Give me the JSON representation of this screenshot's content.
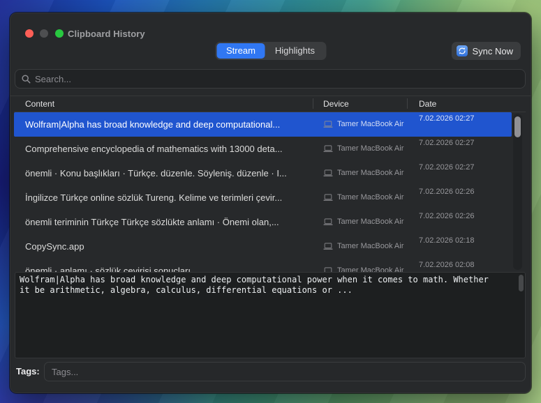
{
  "window": {
    "title": "Clipboard History"
  },
  "traffic_lights": {
    "close_color": "#fe5f57",
    "minimize_color": "#4e4f51",
    "zoom_color": "#28c840"
  },
  "toolbar": {
    "tabs": [
      {
        "label": "Stream",
        "active": true
      },
      {
        "label": "Highlights",
        "active": false
      }
    ],
    "sync_button": {
      "label": "Sync Now"
    }
  },
  "search": {
    "placeholder": "Search..."
  },
  "table": {
    "columns": [
      "Content",
      "Device",
      "Date"
    ],
    "rows": [
      {
        "content": "Wolfram|Alpha has broad knowledge and deep computational...",
        "device": "Tamer MacBook Air",
        "date": "7.02.2026 02:27",
        "selected": true
      },
      {
        "content": "Comprehensive encyclopedia of mathematics with 13000 deta...",
        "device": "Tamer MacBook Air",
        "date": "7.02.2026 02:27",
        "selected": false
      },
      {
        "content": "önemli · Konu başlıkları · Türkçe. düzenle. Söyleniş. düzenle · I...",
        "device": "Tamer MacBook Air",
        "date": "7.02.2026 02:27",
        "selected": false
      },
      {
        "content": "İngilizce Türkçe online sözlük Tureng. Kelime ve terimleri çevir...",
        "device": "Tamer MacBook Air",
        "date": "7.02.2026 02:26",
        "selected": false
      },
      {
        "content": "önemli teriminin Türkçe Türkçe sözlükte anlamı · Önemi olan,...",
        "device": "Tamer MacBook Air",
        "date": "7.02.2026 02:26",
        "selected": false
      },
      {
        "content": "CopySync.app",
        "device": "Tamer MacBook Air",
        "date": "7.02.2026 02:18",
        "selected": false
      },
      {
        "content": "önemli · anlamı · sözlük çevirisi sonuçları ...",
        "device": "Tamer MacBook Air",
        "date": "7.02.2026 02:08",
        "selected": false,
        "clipped": true
      }
    ]
  },
  "preview": {
    "text": "Wolfram|Alpha has broad knowledge and deep computational power when it comes to math. Whether\nit be arithmetic, algebra, calculus, differential equations or ..."
  },
  "tags": {
    "label": "Tags:",
    "placeholder": "Tags..."
  },
  "icons": {
    "search": "magnifier",
    "sync": "circular-arrows",
    "device": "laptop"
  },
  "colors": {
    "selection_blue": "#2055cf",
    "segment_active_blue": "#3077f3",
    "window_bg": "#27292b",
    "preview_bg": "#1d1f20"
  }
}
